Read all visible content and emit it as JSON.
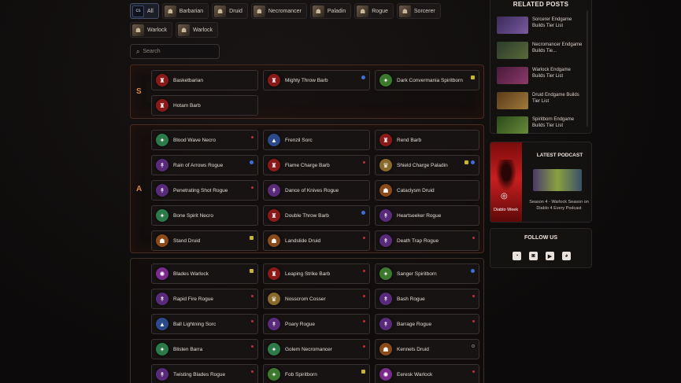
{
  "filters": [
    {
      "label": "All",
      "short": "cs"
    },
    {
      "label": "Barbarian"
    },
    {
      "label": "Druid"
    },
    {
      "label": "Necromancer"
    },
    {
      "label": "Paladin"
    },
    {
      "label": "Rogue"
    },
    {
      "label": "Sorcerer"
    },
    {
      "label": "Warlock"
    },
    {
      "label": "Warlock"
    }
  ],
  "search": {
    "placeholder": "Search"
  },
  "tiers": {
    "s": {
      "letter": "S",
      "builds": [
        "Basketbarian",
        "Mighty Throw Barb",
        "Dark Convermania Spiritborn",
        "Hotam Barb"
      ]
    },
    "a": {
      "letter": "A",
      "builds": [
        "Blood Wave Necro",
        "Frenzil Sorc",
        "Rend Barb",
        "Rain of Arrows Rogue",
        "Flame Charge Barb",
        "Shield Charge Paladin",
        "Penetrating Shot Rogue",
        "Dance of Knives Rogue",
        "Cataclysm Druid",
        "Bone Spirit Necro",
        "Double Throw Barb",
        "Heartseeker Rogue",
        "Stand Druid",
        "Landslide Druid",
        "Death Trap Rogue"
      ]
    },
    "b": {
      "letter": "",
      "builds": [
        "Blades Warlock",
        "Leaping Strike Barb",
        "Sanger Spiritborn",
        "Rapid Fire Rogue",
        "Nosscrom Cosser",
        "Bash Rogue",
        "Ball Lightning Sorc",
        "Poary Rogue",
        "Barrage Rogue",
        "Blisten Barra",
        "Golem Necromancer",
        "Kennels Druid",
        "Twisting Blades Rogue",
        "Fob Spiritborn",
        "Eeresk Warlock"
      ]
    }
  },
  "related": {
    "title": "RELATED POSTS",
    "posts": [
      "Sorcerer Endgame Builds Tier List",
      "Necromancer Endgame Builds Tie...",
      "Warlock Endgame Builds Tier List",
      "Druid Endgame Builds Tier List",
      "Spiritborn Endgame Builds Tier List"
    ]
  },
  "podcast": {
    "title": "LATEST PODCAST",
    "art_caption": "Diablo Week",
    "description": "Season 4 - Warlock Season on Diablo 4 Every Podcast"
  },
  "follow": {
    "title": "FOLLOW US"
  },
  "colors": {
    "accent": "#d98a3c",
    "tier_border": "#4a2a20"
  }
}
